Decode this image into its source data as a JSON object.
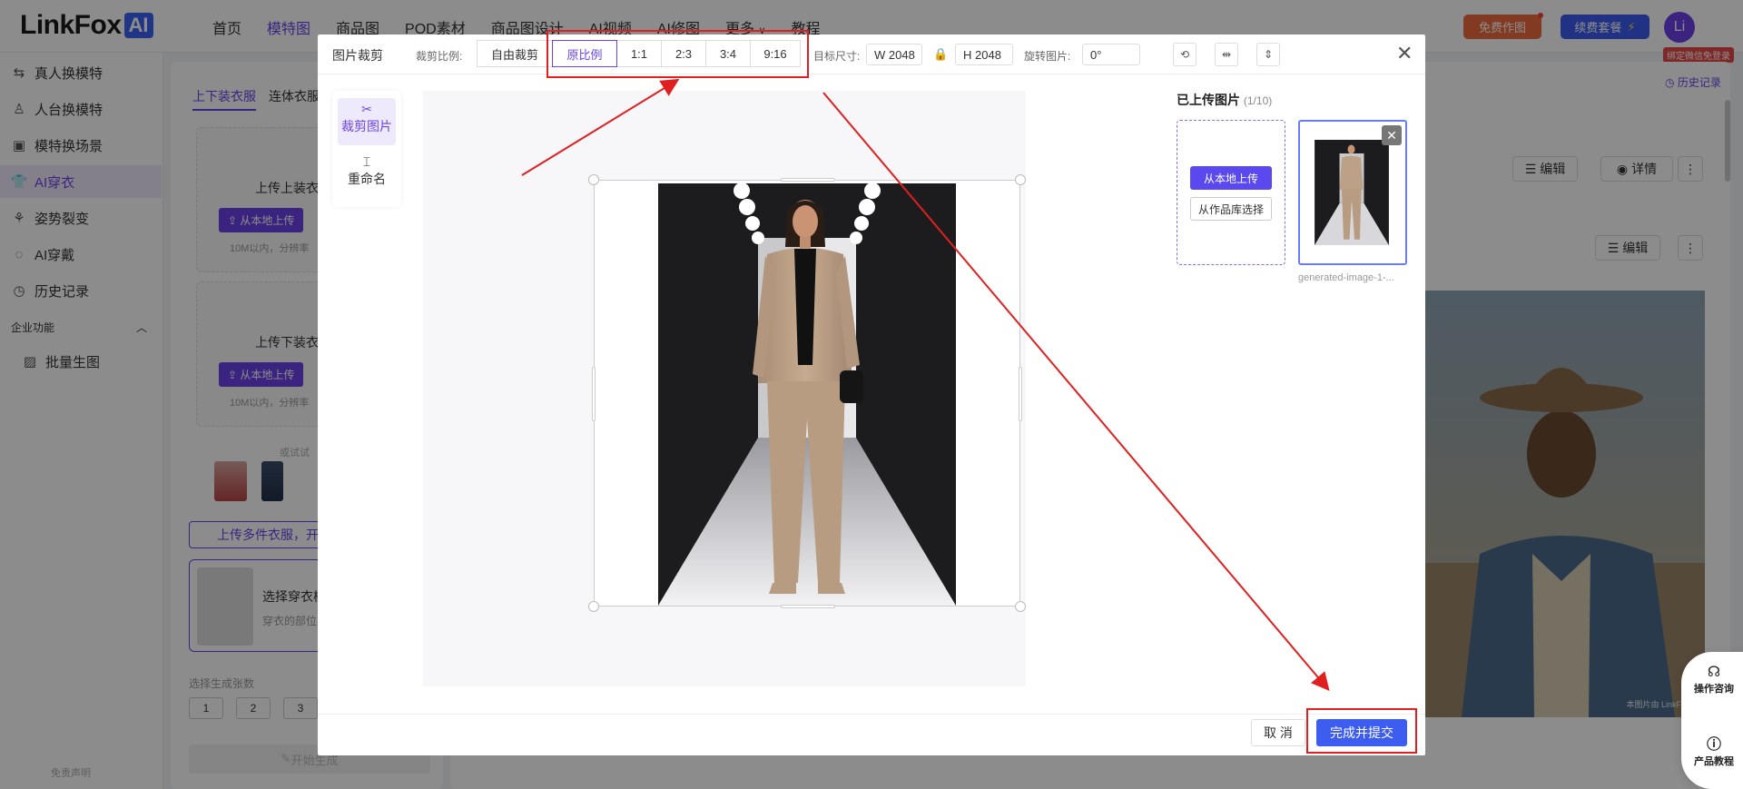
{
  "app": {
    "logo_text": "LinkFox",
    "logo_badge": "AI"
  },
  "nav": [
    "首页",
    "模特图",
    "商品图",
    "POD素材",
    "商品图设计",
    "AI视频",
    "AI修图",
    "更多",
    "教程"
  ],
  "header": {
    "free_btn": "免费作图",
    "renew_btn": "续费套餐",
    "avatar": "Li",
    "bind_tip": "绑定微信免登录"
  },
  "sidebar": {
    "items": [
      "真人换模特",
      "人台换模特",
      "模特换场景",
      "AI穿衣",
      "姿势裂变",
      "AI穿戴",
      "历史记录"
    ],
    "active_index": 3,
    "section_title": "企业功能",
    "section_items": [
      "批量生图"
    ],
    "footer": "免责声明"
  },
  "panel": {
    "tabs": [
      "上下装衣服",
      "连体衣服"
    ],
    "upload_top_title": "上传上装衣",
    "upload_bottom_title": "上传下装衣",
    "upload_btn": "从本地上传",
    "upload_note": "10M以内，分辨率",
    "try_label": "或试试",
    "multi_btn": "上传多件衣服，开",
    "model_title": "选择穿衣模",
    "model_sub": "穿衣的部位",
    "gen_label": "选择生成张数",
    "gen_counts": [
      "1",
      "2",
      "3"
    ],
    "start_btn": "开始生成"
  },
  "main": {
    "history": "历史记录",
    "edit": "编辑",
    "detail": "详情",
    "watermark": "本图片由 LinkFoxAI",
    "help": "操作咨询",
    "tutorial": "产品教程"
  },
  "modal": {
    "title": "图片裁剪",
    "ratio_label": "裁剪比例:",
    "ratios": [
      "自由裁剪",
      "原比例",
      "1:1",
      "2:3",
      "3:4",
      "9:16"
    ],
    "active_ratio": "原比例",
    "size_label": "目标尺寸:",
    "width": "W 2048",
    "height": "H 2048",
    "rotate_label": "旋转图片:",
    "rotate_value": "0°",
    "tools": [
      "crop-tool",
      "rename-tool"
    ],
    "crop_label": "裁剪图片",
    "rename_label": "重命名",
    "uploaded_title": "已上传图片",
    "uploaded_count": "(1/10)",
    "upload_local": "从本地上传",
    "upload_library": "从作品库选择",
    "thumb_name": "generated-image-1-...",
    "cancel": "取 消",
    "submit": "完成并提交"
  },
  "colors": {
    "accent": "#6a43e8",
    "primary": "#3d5cf0",
    "annotation": "#e02020"
  }
}
